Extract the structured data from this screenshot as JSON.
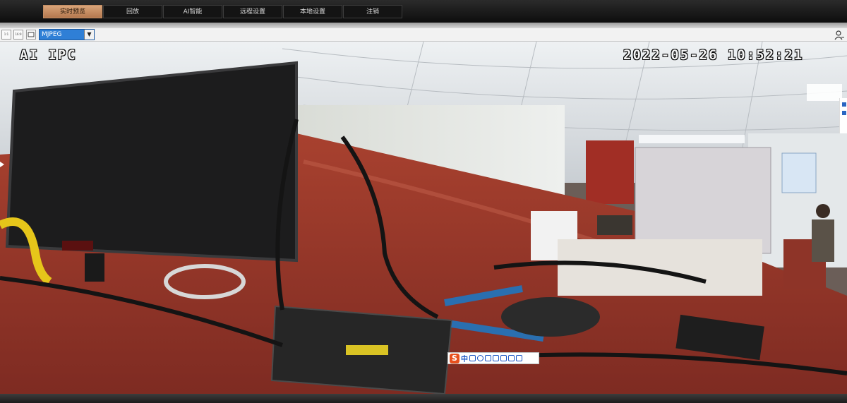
{
  "nav": {
    "items": [
      {
        "label": "实时预览",
        "active": true
      },
      {
        "label": "回放",
        "active": false
      },
      {
        "label": "AI智能",
        "active": false
      },
      {
        "label": "远程设置",
        "active": false
      },
      {
        "label": "本地设置",
        "active": false
      },
      {
        "label": "注销",
        "active": false
      }
    ]
  },
  "toolbar": {
    "btn_1_label": "1:1",
    "btn_2_label": "16:9",
    "stream_type": "MJPEG"
  },
  "video": {
    "osd_channel_name": "AI IPC",
    "osd_timestamp": "2022-05-26 10:52:21"
  },
  "ime": {
    "char_label": "中"
  },
  "colors": {
    "nav_active": "#c68a5e",
    "select_bg": "#2f7fd6"
  }
}
